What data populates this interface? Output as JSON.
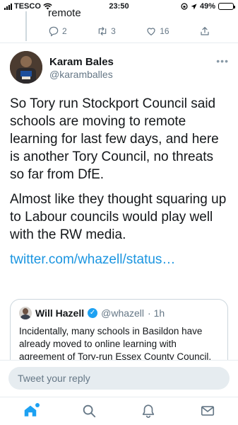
{
  "status_bar": {
    "carrier": "TESCO",
    "time": "23:50",
    "battery": "49%",
    "battery_level": 0.49
  },
  "previous_tweet": {
    "text_tail": "remote",
    "reply_count": "2",
    "retweet_count": "3",
    "like_count": "16"
  },
  "tweet": {
    "author_name": "Karam Bales",
    "author_handle": "@karamballes",
    "paragraph_1": "So Tory run Stockport Council said schools are moving to remote learning for last few days, and here is another Tory Council, no threats so far from DfE.",
    "paragraph_2": "Almost like they thought squaring up to Labour councils would play well with the RW media.",
    "link": "twitter.com/whazell/status…"
  },
  "quoted_tweet": {
    "name": "Will Hazell",
    "handle": "@whazell",
    "time": "· 1h",
    "text": "Incidentally, many schools in Basildon have already moved to online learning with agreement of Tory-run Essex County Council."
  },
  "reply": {
    "placeholder": "Tweet your reply"
  },
  "icons": {
    "reply": "reply-icon",
    "retweet": "retweet-icon",
    "like": "heart-icon",
    "share": "share-icon",
    "home": "home-icon",
    "search": "search-icon",
    "notifications": "bell-icon",
    "messages": "mail-icon"
  },
  "colors": {
    "accent": "#1da1f2",
    "link": "#1b95e0",
    "secondary_text": "#657786"
  }
}
